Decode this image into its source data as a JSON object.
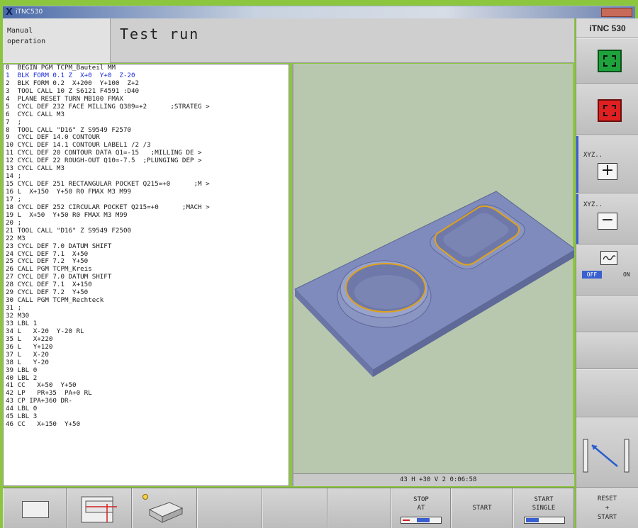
{
  "window": {
    "title": "iTNC530"
  },
  "header": {
    "machine_mode": "Manual\noperation",
    "program_mode": "Test run"
  },
  "brand": "iTNC 530",
  "right_softkeys": [
    {
      "icon": "green-frame-icon"
    },
    {
      "icon": "red-frame-icon"
    },
    {
      "label": "XYZ..",
      "action": "+"
    },
    {
      "label": "XYZ..",
      "action": "−"
    },
    {
      "icon": "wave-icon",
      "off_label": "OFF",
      "on_label": "ON"
    },
    {
      "label": ""
    },
    {
      "label": ""
    },
    {
      "label": ""
    },
    {
      "icon": "speed-slider-icon"
    }
  ],
  "program": [
    "0  BEGIN PGM TCPM_Bauteil MM",
    "1  BLK FORM 0.1 Z  X+0  Y+0  Z-20",
    "2  BLK FORM 0.2  X+200  Y+100  Z+2",
    "3  TOOL CALL 10 Z S6121 F4591 :D40",
    "4  PLANE RESET TURN MB100 FMAX",
    "5  CYCL DEF 232 FACE MILLING Q389=+2      ;STRATEG >",
    "6  CYCL CALL M3",
    "7  ;",
    "8  TOOL CALL \"D16\" Z S9549 F2570",
    "9  CYCL DEF 14.0 CONTOUR",
    "10 CYCL DEF 14.1 CONTOUR LABEL1 /2 /3",
    "11 CYCL DEF 20 CONTOUR DATA Q1=-15   ;MILLING DE >",
    "12 CYCL DEF 22 ROUGH-OUT Q10=-7.5  ;PLUNGING DEP >",
    "13 CYCL CALL M3",
    "14 ;",
    "15 CYCL DEF 251 RECTANGULAR POCKET Q215=+0      ;M >",
    "16 L  X+150  Y+50 R0 FMAX M3 M99",
    "17 ;",
    "18 CYCL DEF 252 CIRCULAR POCKET Q215=+0      ;MACH >",
    "19 L  X+50  Y+50 R0 FMAX M3 M99",
    "20 ;",
    "21 TOOL CALL \"D16\" Z S9549 F2500",
    "22 M3",
    "23 CYCL DEF 7.0 DATUM SHIFT",
    "24 CYCL DEF 7.1  X+50",
    "25 CYCL DEF 7.2  Y+50",
    "26 CALL PGM TCPM_Kreis",
    "27 CYCL DEF 7.0 DATUM SHIFT",
    "28 CYCL DEF 7.1  X+150",
    "29 CYCL DEF 7.2  Y+50",
    "30 CALL PGM TCPM_Rechteck",
    "31 ;",
    "32 M30",
    "33 LBL 1",
    "34 L   X-20  Y-20 RL",
    "35 L   X+220",
    "36 L   Y+120",
    "37 L   X-20",
    "38 L   Y-20",
    "39 LBL 0",
    "40 LBL 2",
    "41 CC   X+50  Y+50",
    "42 LP   PR+35  PA+0 RL",
    "43 CP IPA+360 DR-",
    "44 LBL 0",
    "45 LBL 3",
    "46 CC   X+150  Y+50"
  ],
  "highlight_lines": [
    1
  ],
  "graphics_status": "43 H +30 V 2     0:06:58",
  "bottom_softkeys": [
    {
      "label": ""
    },
    {
      "label": ""
    },
    {
      "label": ""
    },
    {
      "label": ""
    },
    {
      "label": ""
    },
    {
      "label": ""
    },
    {
      "label": "STOP\nAT"
    },
    {
      "label": "START"
    },
    {
      "label": "START\nSINGLE"
    }
  ],
  "reset_key": "RESET\n+\nSTART",
  "colors": {
    "highlight": "#1e2bd6",
    "workpiece": "#7f8bbd",
    "pocket_edge": "#e0a21a",
    "graphics_bg": "#b8c8ae"
  }
}
